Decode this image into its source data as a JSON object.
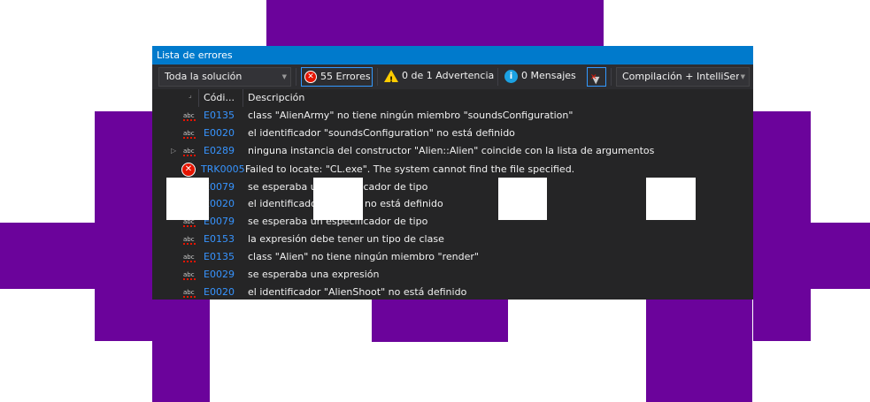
{
  "window": {
    "title": "Lista de errores"
  },
  "toolbar": {
    "scope": "Toda la solución",
    "errors_label": "55 Errores",
    "warnings_label": "0 de 1 Advertencia",
    "messages_label": "0 Mensajes",
    "build_filter": "Compilación + IntelliSen"
  },
  "columns": {
    "code": "Códi...",
    "description": "Descripción"
  },
  "rows": [
    {
      "code": "E0135",
      "description": "class \"AlienArmy\" no tiene ningún miembro \"soundsConfiguration\""
    },
    {
      "code": "E0020",
      "description": "el identificador \"soundsConfiguration\" no está definido"
    },
    {
      "code": "E0289",
      "description": "ninguna instancia del constructor \"Alien::Alien\" coincide con la lista de argumentos"
    },
    {
      "code": "TRK0005",
      "description": "Failed to locate: \"CL.exe\". The system cannot find the file specified."
    },
    {
      "code": "E0079",
      "description": "se esperaba un especificador de tipo"
    },
    {
      "code": "E0020",
      "description": "el identificador \"...mer\" no está definido"
    },
    {
      "code": "E0079",
      "description": "se esperaba un especificador de tipo"
    },
    {
      "code": "E0153",
      "description": "la expresión debe tener un tipo de clase"
    },
    {
      "code": "E0135",
      "description": "class \"Alien\" no tiene ningún miembro \"render\""
    },
    {
      "code": "E0029",
      "description": "se esperaba una expresión"
    },
    {
      "code": "E0020",
      "description": "el identificador \"AlienShoot\" no está definido"
    }
  ],
  "colors": {
    "background_shape": "#6b039b",
    "title_bar": "#007acc",
    "panel": "#252526",
    "error_code_link": "#3794ff"
  }
}
